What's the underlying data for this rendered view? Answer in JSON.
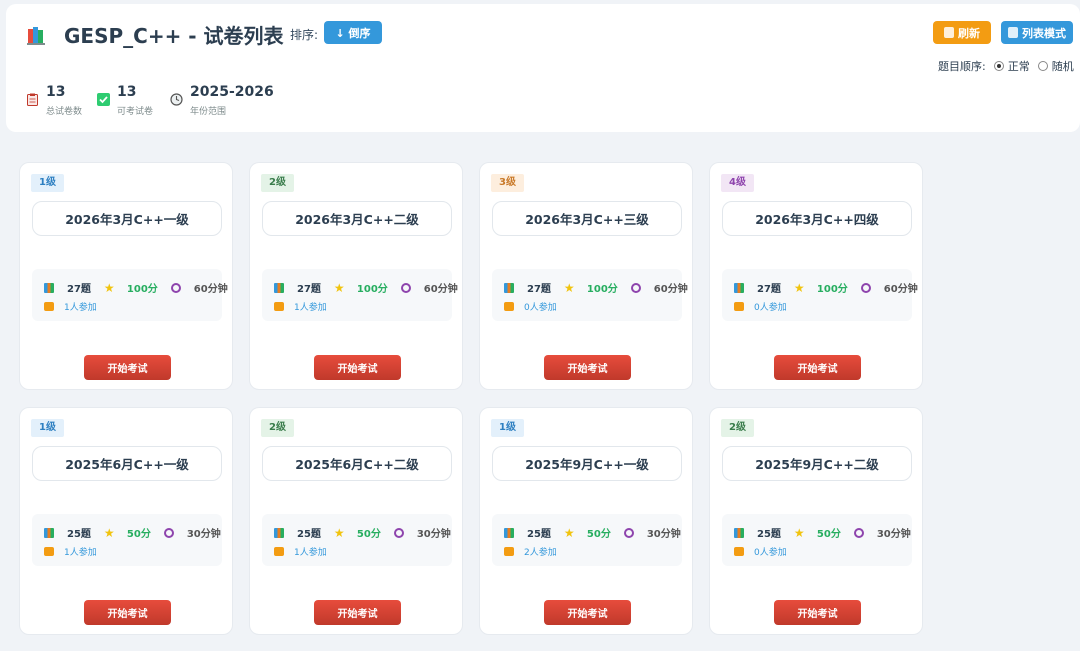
{
  "header": {
    "title": "GESP_C++ - 试卷列表",
    "sort_label": "排序:",
    "sort_button": "↓ 倒序",
    "refresh_button": "刷新",
    "list_mode_button": "列表模式",
    "order_label": "题目顺序:",
    "order_options": [
      "正常",
      "随机"
    ],
    "order_selected": "正常"
  },
  "stats": [
    {
      "value": "13",
      "label": "总试卷数"
    },
    {
      "value": "13",
      "label": "可考试卷"
    },
    {
      "value": "2025-2026",
      "label": "年份范围"
    }
  ],
  "cards": [
    {
      "level": "1级",
      "title": "2026年3月C++一级",
      "questions": "27题",
      "score": "100分",
      "time": "60分钟",
      "participants": "1人参加",
      "button": "开始考试"
    },
    {
      "level": "2级",
      "title": "2026年3月C++二级",
      "questions": "27题",
      "score": "100分",
      "time": "60分钟",
      "participants": "1人参加",
      "button": "开始考试"
    },
    {
      "level": "3级",
      "title": "2026年3月C++三级",
      "questions": "27题",
      "score": "100分",
      "time": "60分钟",
      "participants": "0人参加",
      "button": "开始考试"
    },
    {
      "level": "4级",
      "title": "2026年3月C++四级",
      "questions": "27题",
      "score": "100分",
      "time": "60分钟",
      "participants": "0人参加",
      "button": "开始考试"
    },
    {
      "level": "1级",
      "title": "2025年6月C++一级",
      "questions": "25题",
      "score": "50分",
      "time": "30分钟",
      "participants": "1人参加",
      "button": "开始考试"
    },
    {
      "level": "2级",
      "title": "2025年6月C++二级",
      "questions": "25题",
      "score": "50分",
      "time": "30分钟",
      "participants": "1人参加",
      "button": "开始考试"
    },
    {
      "level": "1级",
      "title": "2025年9月C++一级",
      "questions": "25题",
      "score": "50分",
      "time": "30分钟",
      "participants": "2人参加",
      "button": "开始考试"
    },
    {
      "level": "2级",
      "title": "2025年9月C++二级",
      "questions": "25题",
      "score": "50分",
      "time": "30分钟",
      "participants": "0人参加",
      "button": "开始考试"
    }
  ],
  "colors": {
    "primary": "#3498db",
    "warning": "#f39c12",
    "danger": "#e74c3c",
    "success": "#27ae60",
    "background": "#f0f3f7"
  }
}
